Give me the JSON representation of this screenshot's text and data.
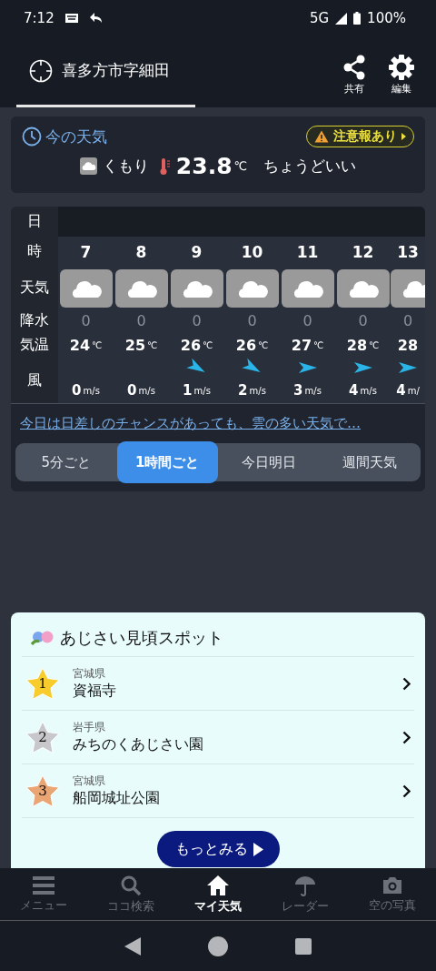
{
  "status_bar": {
    "time": "7:12",
    "network": "5G",
    "battery": "100%"
  },
  "header": {
    "location": "喜多方市字細田",
    "actions": [
      {
        "kind": "share",
        "label": "共有"
      },
      {
        "kind": "settings",
        "label": "編集"
      }
    ]
  },
  "current": {
    "title": "今の天気",
    "alert": "注意報あり",
    "condition": "くもり",
    "temperature": "23.8",
    "unit": "℃",
    "feel": "ちょうどいい"
  },
  "hourly": {
    "labels": {
      "date": "日",
      "hour": "時",
      "weather": "天気",
      "precip": "降水",
      "temp": "気温",
      "wind": "風"
    },
    "hours": [
      {
        "kind": "calm",
        "hour": "7",
        "precip": "0",
        "temp": "24",
        "temp_unit": "℃",
        "wind": "0",
        "wind_unit": "m/s"
      },
      {
        "kind": "calm",
        "hour": "8",
        "precip": "0",
        "temp": "25",
        "temp_unit": "℃",
        "wind": "0",
        "wind_unit": "m/s"
      },
      {
        "kind": "diagonal",
        "hour": "9",
        "precip": "0",
        "temp": "26",
        "temp_unit": "℃",
        "wind": "1",
        "wind_unit": "m/s"
      },
      {
        "kind": "diagonal",
        "hour": "10",
        "precip": "0",
        "temp": "26",
        "temp_unit": "℃",
        "wind": "2",
        "wind_unit": "m/s"
      },
      {
        "kind": "straight",
        "hour": "11",
        "precip": "0",
        "temp": "27",
        "temp_unit": "℃",
        "wind": "3",
        "wind_unit": "m/s"
      },
      {
        "kind": "straight",
        "hour": "12",
        "precip": "0",
        "temp": "28",
        "temp_unit": "℃",
        "wind": "4",
        "wind_unit": "m/s"
      },
      {
        "kind": "straight",
        "hour": "13",
        "precip": "0",
        "temp": "28",
        "wind": "4",
        "wind_unit": "m/"
      }
    ],
    "summary": "今日は日差しのチャンスがあっても、雲の多い天気で…",
    "modes": [
      {
        "label": "5分ごと",
        "selected": false
      },
      {
        "label": "1時間ごと",
        "selected": true
      },
      {
        "label": "今日明日",
        "selected": false
      },
      {
        "label": "週間天気",
        "selected": false
      }
    ]
  },
  "spots": {
    "title": "あじさい見頃スポット",
    "items": [
      {
        "rank": "1",
        "color": "#f8cc2c",
        "prefecture": "宮城県",
        "name": "資福寺"
      },
      {
        "rank": "2",
        "color": "#c8c8cc",
        "prefecture": "岩手県",
        "name": "みちのくあじさい園"
      },
      {
        "rank": "3",
        "color": "#eaa574",
        "prefecture": "宮城県",
        "name": "船岡城址公園"
      }
    ],
    "more": "もっとみる"
  },
  "bottom_nav": [
    {
      "kind": "menu",
      "label": "メニュー",
      "selected": false
    },
    {
      "kind": "search",
      "label": "ココ検索",
      "selected": false
    },
    {
      "kind": "home",
      "label": "マイ天気",
      "selected": true
    },
    {
      "kind": "radar",
      "label": "レーダー",
      "selected": false
    },
    {
      "kind": "camera",
      "label": "空の写真",
      "selected": false
    }
  ]
}
